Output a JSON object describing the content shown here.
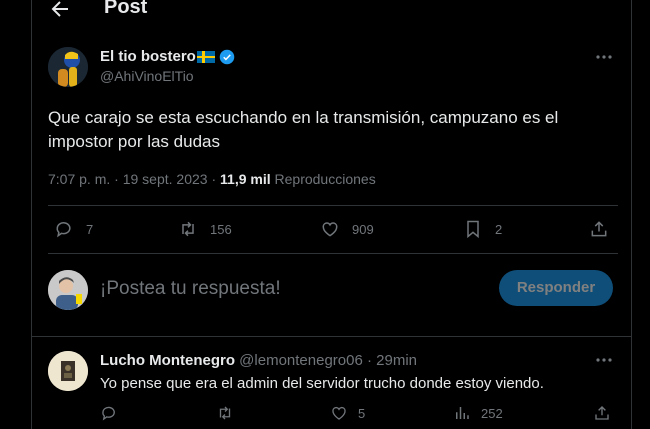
{
  "header": {
    "title": "Post"
  },
  "tweet": {
    "author_name": "El tio bostero",
    "author_handle": "@AhiVinoElTio",
    "text": "Que carajo se esta escuchando en la transmisión, campuzano es el impostor por las dudas",
    "time": "7:07 p. m.",
    "separator": " · ",
    "date": "19 sept. 2023",
    "separator2": " · ",
    "views": "11,9 mil",
    "views_label": "Reproducciones",
    "stats": {
      "replies": "7",
      "reposts": "156",
      "likes": "909",
      "bookmarks": "2"
    }
  },
  "composer": {
    "placeholder": "¡Postea tu respuesta!",
    "button": "Responder"
  },
  "reply": {
    "author_name": "Lucho Montenegro",
    "author_handle": "@lemontenegro06",
    "separator": " · ",
    "time": "29min",
    "text": "Yo pense que era el admin del servidor trucho donde estoy viendo.",
    "stats": {
      "likes": "5",
      "views": "252"
    }
  },
  "colors": {
    "background": "#000000",
    "text": "#e7e9ea",
    "muted": "#71767b",
    "accent": "#1d9bf0",
    "border": "#2f3336"
  },
  "icons": [
    "arrow-left",
    "verified-badge",
    "more-dots",
    "reply",
    "repost",
    "like",
    "bookmark",
    "share",
    "views"
  ]
}
